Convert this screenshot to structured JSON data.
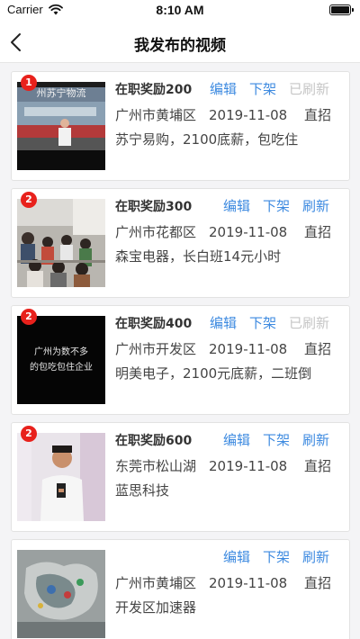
{
  "status_bar": {
    "carrier": "Carrier",
    "time": "8:10 AM"
  },
  "nav": {
    "title": "我发布的视频"
  },
  "videos": [
    {
      "badge": "1",
      "reward": "在职奖励200",
      "actions": {
        "edit": "编辑",
        "offline": "下架",
        "refresh": "已刷新",
        "refresh_enabled": false
      },
      "district": "广州市黄埔区",
      "date": "2019-11-08",
      "mode": "直招",
      "desc": "苏宁易购，2100底薪，包吃住",
      "thumb_caption": "州苏宁物流"
    },
    {
      "badge": "2",
      "reward": "在职奖励300",
      "actions": {
        "edit": "编辑",
        "offline": "下架",
        "refresh": "刷新",
        "refresh_enabled": true
      },
      "district": "广州市花都区",
      "date": "2019-11-08",
      "mode": "直招",
      "desc": "森宝电器，长白班14元小时"
    },
    {
      "badge": "2",
      "reward": "在职奖励400",
      "actions": {
        "edit": "编辑",
        "offline": "下架",
        "refresh": "已刷新",
        "refresh_enabled": false
      },
      "district": "广州市开发区",
      "date": "2019-11-08",
      "mode": "直招",
      "desc": "明美电子，2100元底薪，二班倒",
      "thumb_lines": [
        "广州为数不多",
        "的包吃包住企业"
      ]
    },
    {
      "badge": "2",
      "reward": "在职奖励600",
      "actions": {
        "edit": "编辑",
        "offline": "下架",
        "refresh": "刷新",
        "refresh_enabled": true
      },
      "district": "东莞市松山湖",
      "date": "2019-11-08",
      "mode": "直招",
      "desc": "蓝思科技"
    },
    {
      "badge": "",
      "reward": "",
      "actions": {
        "edit": "编辑",
        "offline": "下架",
        "refresh": "刷新",
        "refresh_enabled": true
      },
      "district": "广州市黄埔区",
      "date": "2019-11-08",
      "mode": "直招",
      "desc": "开发区加速器"
    }
  ]
}
